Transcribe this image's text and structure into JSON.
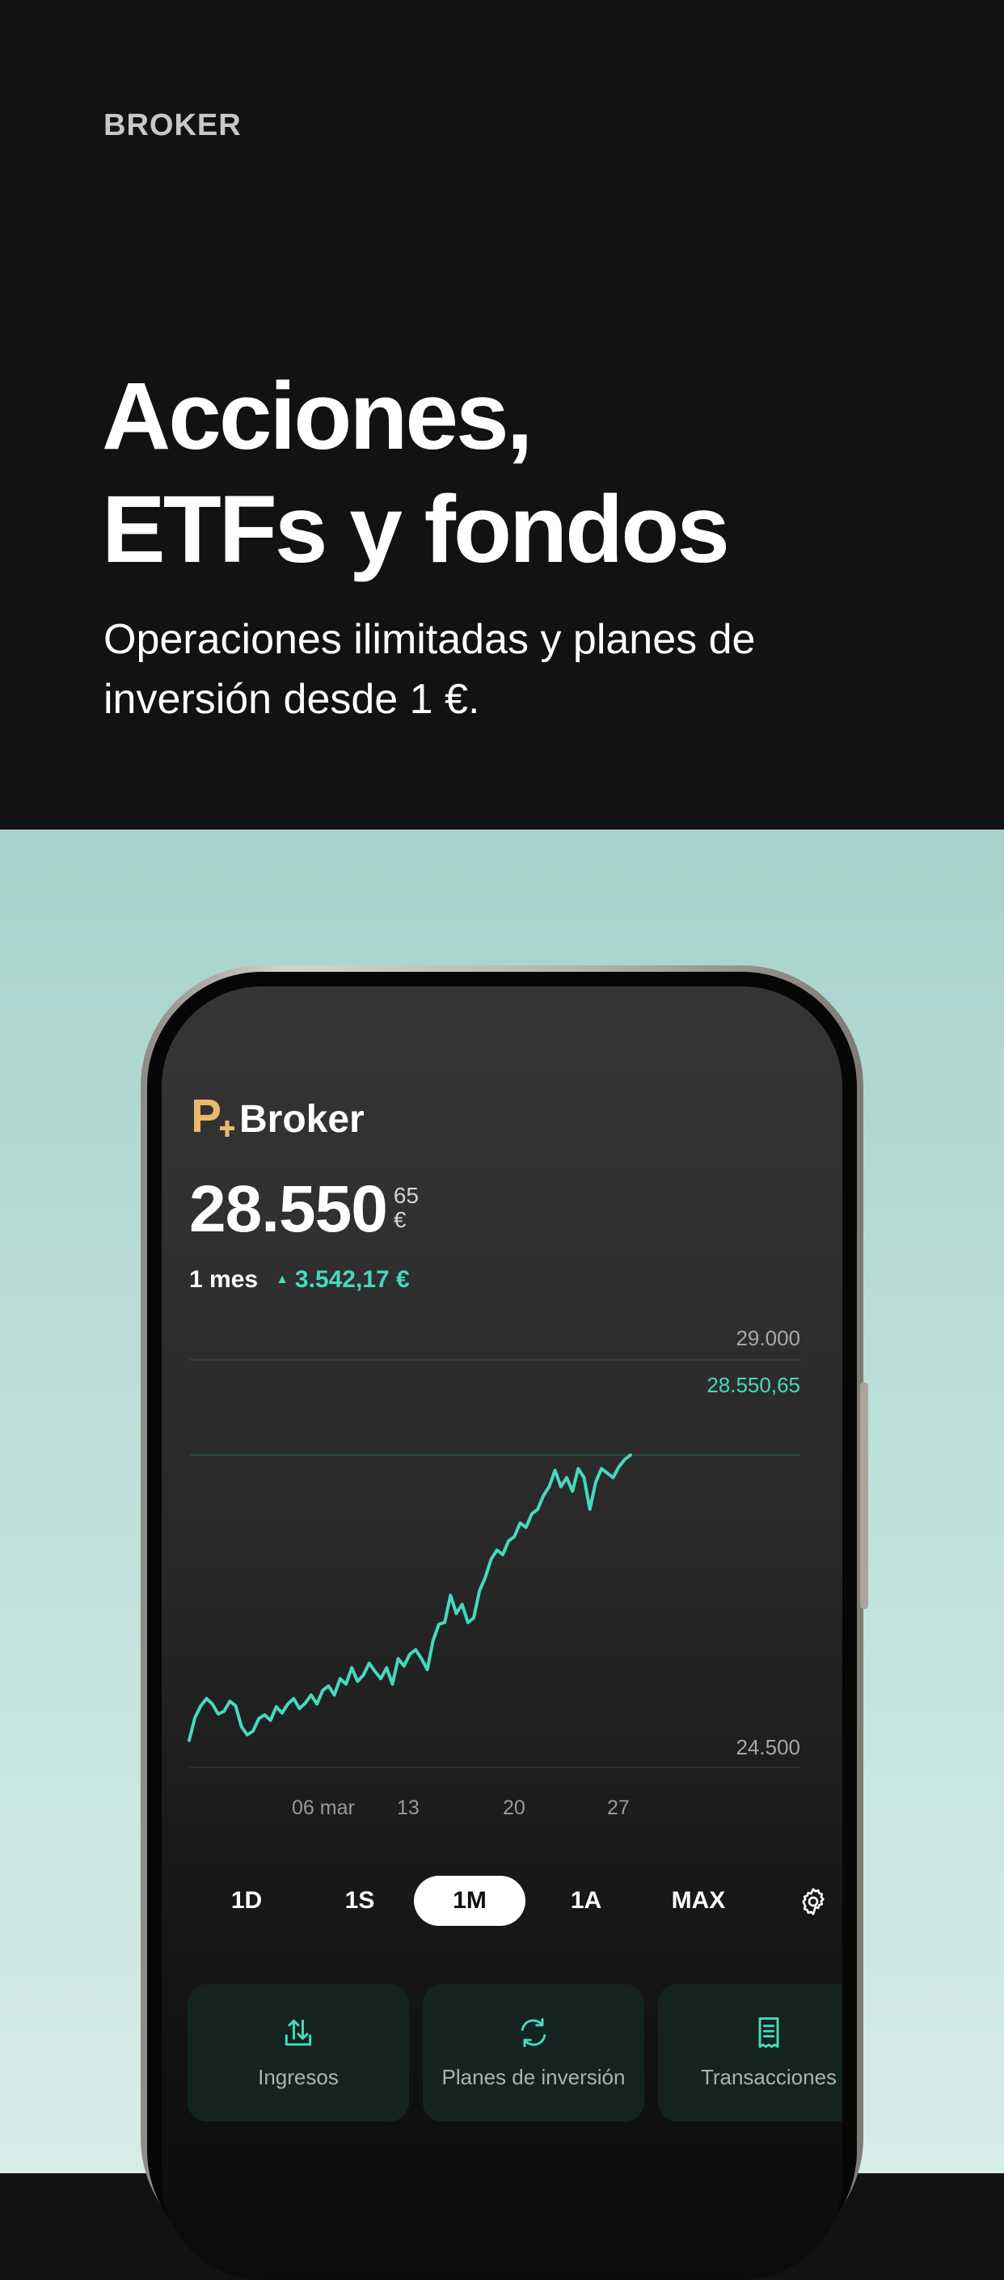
{
  "hero": {
    "eyebrow": "BROKER",
    "headline_line1": "Acciones,",
    "headline_line2": "ETFs y fondos",
    "subline_line1": "Operaciones ilimitadas y planes de",
    "subline_line2": "inversión desde 1 €.",
    "background": "#111214"
  },
  "app": {
    "brand": "Broker",
    "logo_color": "#e9b86a",
    "balance_main": "28.550",
    "balance_cents": "65",
    "currency": "€",
    "period": "1 mes",
    "change": "3.542,17 €",
    "accent": "#46d9bd"
  },
  "chart_data": {
    "type": "line",
    "y_top_label": "29.000",
    "y_bottom_label": "24.500",
    "last_value_label": "28.550,65",
    "ylim": [
      24500,
      29000
    ],
    "x_tick_labels": [
      "06 mar",
      "13",
      "20",
      "27"
    ],
    "series": [
      {
        "color": "#46d9bd",
        "values": [
          24800,
          25050,
          25180,
          25260,
          25200,
          25090,
          25120,
          25230,
          25180,
          24950,
          24860,
          24900,
          25040,
          25080,
          25020,
          25170,
          25100,
          25200,
          25260,
          25150,
          25210,
          25300,
          25200,
          25350,
          25400,
          25300,
          25480,
          25420,
          25600,
          25450,
          25520,
          25650,
          25560,
          25480,
          25600,
          25420,
          25700,
          25620,
          25750,
          25800,
          25700,
          25580,
          25900,
          26080,
          26100,
          26400,
          26200,
          26300,
          26100,
          26150,
          26450,
          26600,
          26800,
          26900,
          26850,
          27000,
          27050,
          27200,
          27150,
          27300,
          27350,
          27500,
          27600,
          27780,
          27600,
          27700,
          27550,
          27800,
          27700,
          27350,
          27650,
          27800,
          27750,
          27700,
          27820,
          27900,
          27950
        ]
      }
    ]
  },
  "ranges": {
    "items": [
      "1D",
      "1S",
      "1M",
      "1A",
      "MAX"
    ],
    "active": "1M"
  },
  "actions": [
    {
      "label": "Ingresos",
      "icon": "deposit-icon"
    },
    {
      "label": "Planes de inversión",
      "icon": "refresh-icon"
    },
    {
      "label": "Transacciones",
      "icon": "receipt-icon"
    }
  ]
}
